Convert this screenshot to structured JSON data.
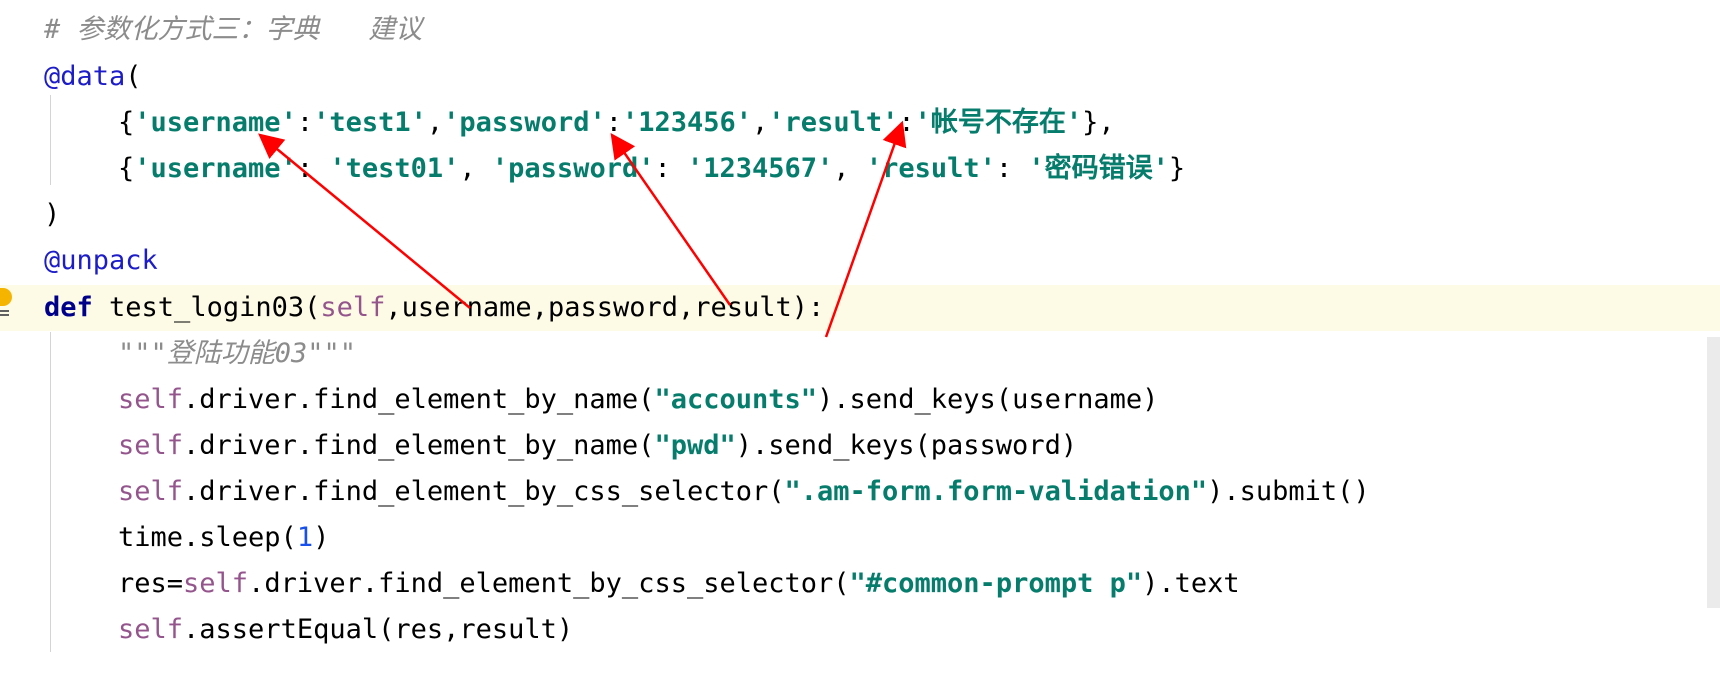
{
  "editor": {
    "comment": "# 参数化方式三：字典   建议",
    "data_decorator": "@data",
    "open_paren": "(",
    "row1": {
      "open": "{",
      "k1": "'username'",
      "sep1": ":",
      "v1": "'test1'",
      "c1": ",",
      "k2": "'password'",
      "sep2": ":",
      "v2": "'123456'",
      "c2": ",",
      "k3": "'result'",
      "sep3": ":",
      "v3": "'帐号不存在'",
      "close": "},"
    },
    "row2": {
      "open": "{",
      "k1": "'username'",
      "sep1": ": ",
      "v1": "'test01'",
      "c1": ", ",
      "k2": "'password'",
      "sep2": ": ",
      "v2": "'1234567'",
      "c2": ", ",
      "k3": "'result'",
      "sep3": ": ",
      "v3": "'密码错误'",
      "close": "}"
    },
    "close_paren": ")",
    "unpack_decorator": "@unpack",
    "def_line": {
      "keyword": "def",
      "name": " test_login03(",
      "self": "self",
      "params": ",username,password,result):"
    },
    "docstring": "\"\"\"登陆功能03\"\"\"",
    "stmt1": {
      "self": "self",
      "call": ".driver.find_element_by_name(",
      "arg": "\"accounts\"",
      "rest": ").send_keys(username)"
    },
    "stmt2": {
      "self": "self",
      "call": ".driver.find_element_by_name(",
      "arg": "\"pwd\"",
      "rest": ").send_keys(password)"
    },
    "stmt3": {
      "self": "self",
      "call": ".driver.find_element_by_css_selector(",
      "arg": "\".am-form.form-validation\"",
      "rest": ").submit()"
    },
    "stmt4": {
      "call": "time.sleep(",
      "num": "1",
      "rest": ")"
    },
    "stmt5": {
      "prefix": "res=",
      "self": "self",
      "call": ".driver.find_element_by_css_selector(",
      "arg": "\"#common-prompt p\"",
      "rest": ").text"
    },
    "stmt6": {
      "self": "self",
      "call": ".assertEqual(res,result)"
    }
  },
  "colors": {
    "comment": "#8c8c8c",
    "decorator": "#1c1cc8",
    "keyword": "#00008b",
    "string": "#067d6c",
    "self": "#94558d",
    "number": "#1750eb",
    "arrow": "#ff0000",
    "current_line": "#fdfbe6"
  },
  "icons": [
    "lightbulb-icon"
  ]
}
